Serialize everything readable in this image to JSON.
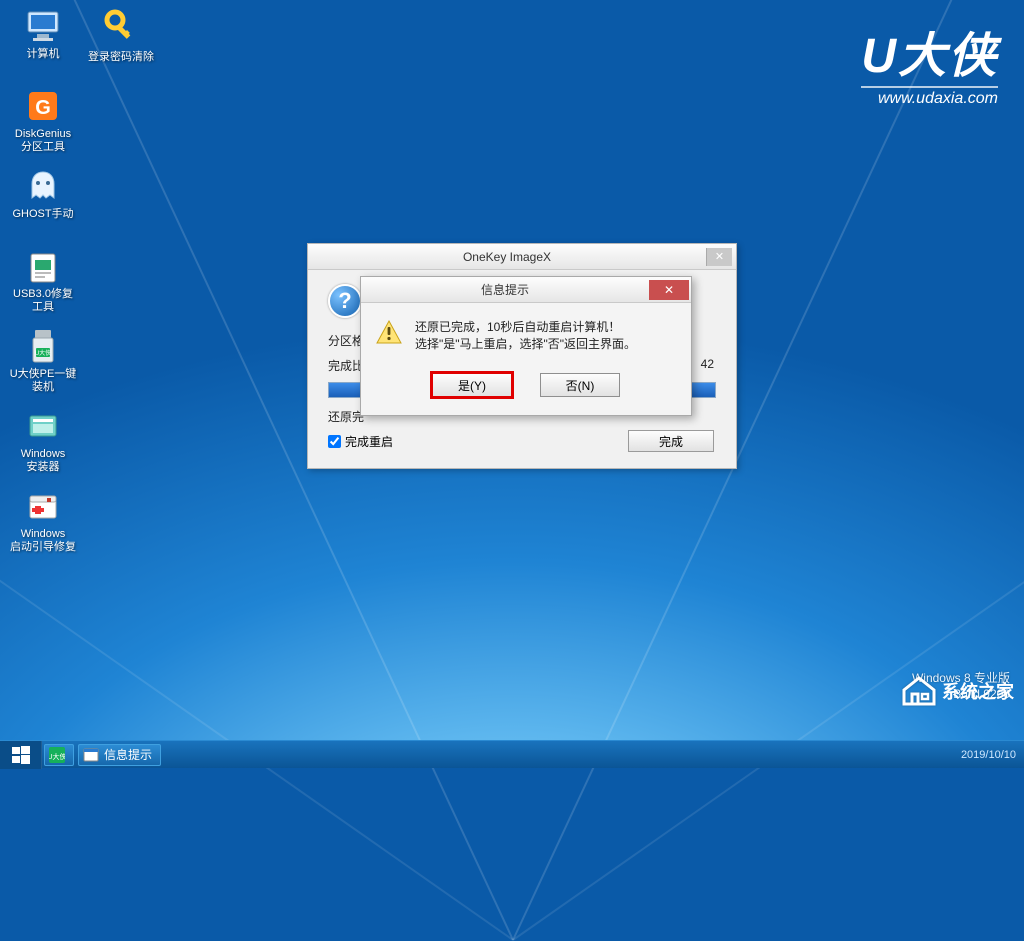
{
  "brand": {
    "name": "U大侠",
    "url": "www.udaxia.com"
  },
  "desktop_icons": [
    {
      "name": "computer-icon",
      "label": "计算机"
    },
    {
      "name": "diskgenius-icon",
      "label": "DiskGenius\n分区工具"
    },
    {
      "name": "ghost-icon",
      "label": "GHOST手动"
    },
    {
      "name": "usb-repair-icon",
      "label": "USB3.0修复\n工具"
    },
    {
      "name": "udaxia-pe-icon",
      "label": "U大侠PE一键\n装机"
    },
    {
      "name": "windows-installer-icon",
      "label": "Windows\n安装器"
    },
    {
      "name": "boot-repair-icon",
      "label": "Windows\n启动引导修复"
    }
  ],
  "desktop_icon_right": {
    "name": "password-clear-icon",
    "label": "登录密码清除"
  },
  "window_main": {
    "title": "OneKey ImageX",
    "partition_label": "分区格",
    "progress_label_prefix": "完成比",
    "progress_tail": "42",
    "restore_done_label": "还原完",
    "checkbox_label": "完成重启",
    "checkbox_checked": true,
    "finish_button": "完成"
  },
  "dialog": {
    "title": "信息提示",
    "message_line1": "还原已完成，10秒后自动重启计算机！",
    "message_line2": "选择\"是\"马上重启，选择\"否\"返回主界面。",
    "yes_button": "是(Y)",
    "no_button": "否(N)"
  },
  "taskbar": {
    "item1_label": "U大侠",
    "item2_label": "信息提示",
    "date": "2019/10/10"
  },
  "os_info": {
    "line1": "Windows 8 专业版",
    "line2": "Build 9200"
  },
  "watermark": "系统之家"
}
